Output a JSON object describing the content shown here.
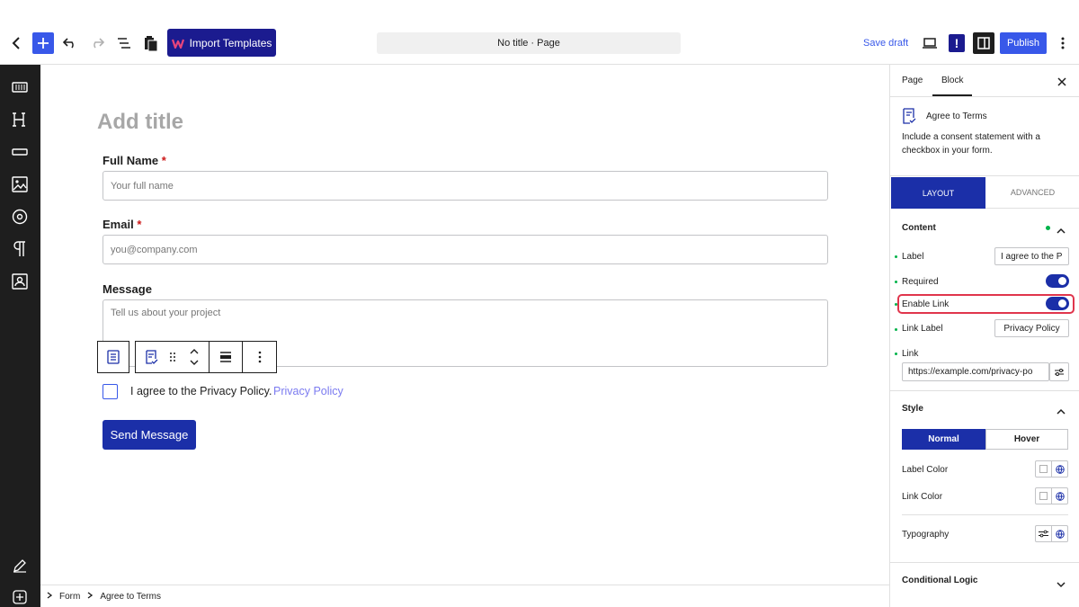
{
  "topbar": {
    "import_label": "Import Templates",
    "doc_title": "No title · Page",
    "save_draft": "Save draft",
    "excl": "!",
    "publish": "Publish"
  },
  "canvas": {
    "add_title": "Add title",
    "fields": {
      "full_name_label": "Full Name",
      "full_name_placeholder": "Your full name",
      "email_label": "Email",
      "email_placeholder": "you@company.com",
      "message_label": "Message",
      "message_placeholder": "Tell us about your project",
      "required_mark": "*"
    },
    "agree_text": "I agree to the Privacy Policy.",
    "privacy_link": "Privacy Policy",
    "send_button": "Send Message"
  },
  "breadcrumb": {
    "items": [
      "Form",
      "Agree to Terms"
    ]
  },
  "sidebar": {
    "tabs": [
      "Page",
      "Block"
    ],
    "active_tab": "Block",
    "block_name": "Agree to Terms",
    "block_desc": "Include a consent statement with a checkbox in your form.",
    "layout_tab": "LAYOUT",
    "advanced_tab": "ADVANCED",
    "content_head": "Content",
    "label_label": "Label",
    "label_value": "I agree to the P",
    "required_label": "Required",
    "required_on": true,
    "enable_link_label": "Enable Link",
    "enable_link_on": true,
    "link_label_label": "Link Label",
    "link_label_value": "Privacy Policy",
    "link_label": "Link",
    "link_value": "https://example.com/privacy-po",
    "style_head": "Style",
    "normal": "Normal",
    "hover": "Hover",
    "label_color": "Label Color",
    "link_color": "Link Color",
    "typography": "Typography",
    "conditional_logic": "Conditional Logic"
  },
  "colors": {
    "accent": "#3858e9",
    "brand_dark": "#1b2fa8",
    "highlight": "#e0354c"
  }
}
